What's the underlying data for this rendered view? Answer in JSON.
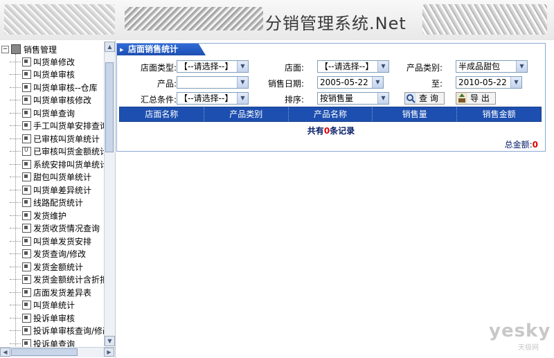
{
  "banner": {
    "title": "分销管理系统.Net"
  },
  "tree": {
    "root": "销售管理",
    "items": [
      {
        "label": "叫货单修改",
        "icon": "form-icon"
      },
      {
        "label": "叫货单审核",
        "icon": "form-icon"
      },
      {
        "label": "叫货单审核--仓库",
        "icon": "form-icon"
      },
      {
        "label": "叫货单审核修改",
        "icon": "form-icon"
      },
      {
        "label": "叫货单查询",
        "icon": "form-icon"
      },
      {
        "label": "手工叫货单安排查询",
        "icon": "form-icon"
      },
      {
        "label": "已审核叫货单统计",
        "icon": "form-icon"
      },
      {
        "label": "已审核叫货金额统计",
        "icon": "u-icon"
      },
      {
        "label": "系统安排叫货单统计",
        "icon": "form-icon"
      },
      {
        "label": "甜包叫货单统计",
        "icon": "form-icon"
      },
      {
        "label": "叫货单差异统计",
        "icon": "form-icon"
      },
      {
        "label": "线路配货统计",
        "icon": "form-icon"
      },
      {
        "label": "发货维护",
        "icon": "form-icon"
      },
      {
        "label": "发货收货情况查询",
        "icon": "form-icon"
      },
      {
        "label": "叫货单发货安排",
        "icon": "form-icon"
      },
      {
        "label": "发货查询/修改",
        "icon": "form-icon"
      },
      {
        "label": "发货金额统计",
        "icon": "form-icon"
      },
      {
        "label": "发货金额统计含折扣",
        "icon": "form-icon"
      },
      {
        "label": "店面发货差异表",
        "icon": "form-icon"
      },
      {
        "label": "叫货单统计",
        "icon": "form-icon"
      },
      {
        "label": "投诉单审核",
        "icon": "form-icon"
      },
      {
        "label": "投诉单审核查询/修改",
        "icon": "form-icon"
      },
      {
        "label": "投诉单查询",
        "icon": "form-icon"
      }
    ]
  },
  "panel": {
    "title": "店面销售统计",
    "store_type_label": "店面类型:",
    "store_type_value": "【--请选择--】",
    "store_label": "店面:",
    "store_value": "【--请选择--】",
    "category_label": "产品类别:",
    "category_value": "半成品甜包",
    "product_label": "产品:",
    "product_value": "",
    "date_label": "销售日期:",
    "date_from": "2005-05-22",
    "to_label": "至:",
    "date_to": "2010-05-22",
    "summary_label": "汇总条件:",
    "summary_value": "【--请选择--】",
    "sort_label": "排序:",
    "sort_value": "按销售量",
    "query_button": "查 询",
    "export_button": "导 出",
    "columns": [
      "店面名称",
      "产品类别",
      "产品名称",
      "销售量",
      "销售金额"
    ],
    "records_prefix": "共有",
    "records_count": "0",
    "records_suffix": "条记录",
    "total_label": "总金额:",
    "total_value": "0"
  },
  "watermark": {
    "main": "yesky",
    "sub": "天极网"
  }
}
